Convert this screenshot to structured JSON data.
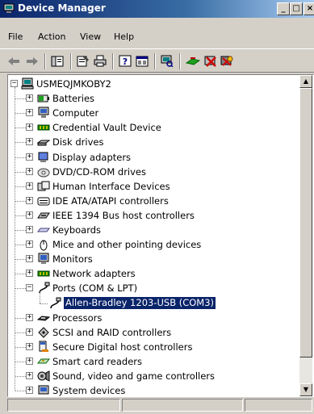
{
  "window": {
    "title": "Device Manager",
    "min_label": "_",
    "max_label": "□",
    "close_label": "×"
  },
  "menubar": {
    "items": [
      "File",
      "Action",
      "View",
      "Help"
    ]
  },
  "toolbar": {
    "icons": [
      "back-icon",
      "forward-icon",
      "tree-view-icon",
      "properties-icon",
      "print-icon",
      "help-icon",
      "console-icon",
      "scan-hardware-icon",
      "update-driver-icon",
      "uninstall-icon",
      "disable-icon"
    ]
  },
  "tree": {
    "root": "USMEQJMKOBY2",
    "items": [
      {
        "label": "Batteries",
        "icon": "battery-icon",
        "expander": "+"
      },
      {
        "label": "Computer",
        "icon": "computer-icon",
        "expander": "+"
      },
      {
        "label": "Credential Vault Device",
        "icon": "credential-vault-icon",
        "expander": "+"
      },
      {
        "label": "Disk drives",
        "icon": "disk-drive-icon",
        "expander": "+"
      },
      {
        "label": "Display adapters",
        "icon": "display-adapter-icon",
        "expander": "+"
      },
      {
        "label": "DVD/CD-ROM drives",
        "icon": "dvd-drive-icon",
        "expander": "+"
      },
      {
        "label": "Human Interface Devices",
        "icon": "hid-icon",
        "expander": "+"
      },
      {
        "label": "IDE ATA/ATAPI controllers",
        "icon": "ide-controller-icon",
        "expander": "+"
      },
      {
        "label": "IEEE 1394 Bus host controllers",
        "icon": "ieee1394-icon",
        "expander": "+"
      },
      {
        "label": "Keyboards",
        "icon": "keyboard-icon",
        "expander": "+"
      },
      {
        "label": "Mice and other pointing devices",
        "icon": "mouse-icon",
        "expander": "+"
      },
      {
        "label": "Monitors",
        "icon": "monitor-icon",
        "expander": "+"
      },
      {
        "label": "Network adapters",
        "icon": "network-adapter-icon",
        "expander": "+"
      },
      {
        "label": "Ports (COM & LPT)",
        "icon": "port-icon",
        "expander": "−"
      },
      {
        "label": "Allen-Bradley 1203-USB (COM3)",
        "icon": "port-icon",
        "child": true,
        "selected": true
      },
      {
        "label": "Processors",
        "icon": "processor-icon",
        "expander": "+"
      },
      {
        "label": "SCSI and RAID controllers",
        "icon": "scsi-icon",
        "expander": "+"
      },
      {
        "label": "Secure Digital host controllers",
        "icon": "sd-host-icon",
        "expander": "+"
      },
      {
        "label": "Smart card readers",
        "icon": "smart-card-icon",
        "expander": "+"
      },
      {
        "label": "Sound, video and game controllers",
        "icon": "sound-icon",
        "expander": "+"
      },
      {
        "label": "System devices",
        "icon": "system-device-icon",
        "expander": "+"
      }
    ]
  },
  "scrollbar": {
    "up": "▲",
    "down": "▼"
  }
}
